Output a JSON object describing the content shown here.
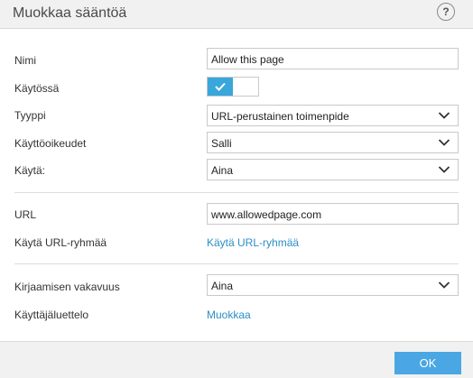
{
  "dialog": {
    "title": "Muokkaa sääntöä",
    "help_icon": "?"
  },
  "form": {
    "name": {
      "label": "Nimi",
      "value": "Allow this page"
    },
    "enabled": {
      "label": "Käytössä",
      "checked": true
    },
    "type": {
      "label": "Tyyppi",
      "value": "URL-perustainen toimenpide"
    },
    "permissions": {
      "label": "Käyttöoikeudet",
      "value": "Salli"
    },
    "apply": {
      "label": "Käytä:",
      "value": "Aina"
    },
    "url": {
      "label": "URL",
      "value": "www.allowedpage.com"
    },
    "url_group": {
      "label": "Käytä URL-ryhmää",
      "link": "Käytä URL-ryhmää"
    },
    "log_severity": {
      "label": "Kirjaamisen vakavuus",
      "value": "Aina"
    },
    "user_list": {
      "label": "Käyttäjäluettelo",
      "link": "Muokkaa"
    }
  },
  "footer": {
    "ok_label": "OK"
  },
  "colors": {
    "accent": "#39a6dc",
    "button": "#4aa7e4",
    "link": "#2c8dc6"
  },
  "icons": [
    "help-icon",
    "check-icon",
    "chevron-down-icon"
  ]
}
